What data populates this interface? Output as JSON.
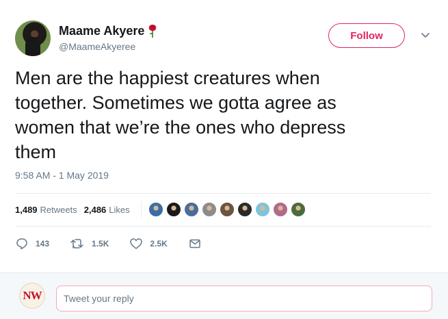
{
  "author": {
    "display_name": "Maame Akyere",
    "handle": "@MaameAkyeree",
    "name_emoji": "rose-icon"
  },
  "follow_label": "Follow",
  "tweet": {
    "lines": [
      "Men are the happiest creatures when",
      "together. Sometimes we gotta agree as",
      "women that we’re the ones who depress",
      "them"
    ],
    "timestamp": "9:58 AM - 1 May 2019"
  },
  "stats": {
    "retweets_count": "1,489",
    "retweets_label": "Retweets",
    "likes_count": "2,486",
    "likes_label": "Likes"
  },
  "liker_avatars": [
    "#3b6ea5",
    "#1a1a1a",
    "#4a6d9c",
    "#8c8c8c",
    "#6b5440",
    "#2a2a2a",
    "#7fc4d8",
    "#b06a8a",
    "#4a6b3c"
  ],
  "actions": {
    "replies": "143",
    "retweets": "1.5K",
    "likes": "2.5K"
  },
  "reply_box": {
    "avatar_text": "NW",
    "placeholder": "Tweet your reply"
  },
  "colors": {
    "accent": "#e0245e",
    "secondary_text": "#657786",
    "divider": "#e6ecf0"
  }
}
